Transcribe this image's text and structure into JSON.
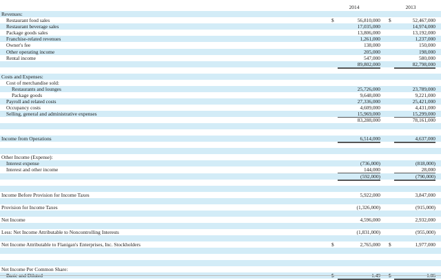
{
  "columns": {
    "y2014": "2014",
    "y2013": "2013",
    "currency": "$"
  },
  "rows": [
    {
      "label": "Revenues:",
      "indent": 0,
      "band": true
    },
    {
      "label": "Restaurant food sales",
      "indent": 1,
      "v2014": "56,810,000",
      "v2013": "52,467,000",
      "cur": true
    },
    {
      "label": "Restaurant beverage sales",
      "indent": 1,
      "v2014": "17,035,000",
      "v2013": "14,974,000",
      "band": true
    },
    {
      "label": "Package goods sales",
      "indent": 1,
      "v2014": "13,806,000",
      "v2013": "13,192,000"
    },
    {
      "label": "Franchise-related revenues",
      "indent": 1,
      "v2014": "1,261,000",
      "v2013": "1,237,000",
      "band": true
    },
    {
      "label": "Owner's fee",
      "indent": 1,
      "v2014": "138,000",
      "v2013": "150,000"
    },
    {
      "label": "Other operating income",
      "indent": 1,
      "v2014": "205,000",
      "v2013": "198,000",
      "band": true
    },
    {
      "label": "Rental income",
      "indent": 1,
      "v2014": "547,000",
      "v2013": "580,000",
      "ul": true
    },
    {
      "label": "",
      "indent": 0,
      "v2014": "89,802,000",
      "v2013": "82,798,000",
      "band": true,
      "dbl": true
    },
    {
      "label": "",
      "indent": 0
    },
    {
      "label": "Costs and Expenses:",
      "indent": 0,
      "band": true
    },
    {
      "label": "Cost of merchandise sold:",
      "indent": 1
    },
    {
      "label": "Restaurants and lounges",
      "indent": 2,
      "v2014": "25,726,000",
      "v2013": "23,789,000",
      "band": true
    },
    {
      "label": "Package goods",
      "indent": 2,
      "v2014": "9,648,000",
      "v2013": "9,221,000"
    },
    {
      "label": "Payroll and related costs",
      "indent": 1,
      "v2014": "27,336,000",
      "v2013": "25,421,000",
      "band": true
    },
    {
      "label": "Occupancy costs",
      "indent": 1,
      "v2014": "4,609,000",
      "v2013": "4,431,000"
    },
    {
      "label": "Selling, general and administrative expenses",
      "indent": 1,
      "v2014": "15,969,000",
      "v2013": "15,299,000",
      "band": true,
      "ul": true
    },
    {
      "label": "",
      "indent": 0,
      "v2014": "83,288,000",
      "v2013": "78,161,000",
      "dbl": true
    },
    {
      "label": "",
      "indent": 0,
      "band": true
    },
    {
      "label": "",
      "indent": 0
    },
    {
      "label": "Income from Operations",
      "indent": 0,
      "v2014": "6,514,000",
      "v2013": "4,637,000",
      "band": true,
      "dbl": true
    },
    {
      "label": "",
      "indent": 0
    },
    {
      "label": "",
      "indent": 0,
      "band": true
    },
    {
      "label": "Other Income (Expense):",
      "indent": 0
    },
    {
      "label": "Interest expense",
      "indent": 1,
      "v2014": "(736,000)",
      "v2013": "(818,000)",
      "band": true
    },
    {
      "label": "Interest and other income",
      "indent": 1,
      "v2014": "144,000",
      "v2013": "28,000",
      "ul": true
    },
    {
      "label": "",
      "indent": 0,
      "v2014": "(592,000)",
      "v2013": "(790,000)",
      "band": true,
      "dbl": true
    },
    {
      "label": "",
      "indent": 0
    },
    {
      "label": "",
      "indent": 0,
      "band": true
    },
    {
      "label": "Income Before Provision for Income Taxes",
      "indent": 0,
      "v2014": "5,922,000",
      "v2013": "3,847,000"
    },
    {
      "label": "",
      "indent": 0,
      "band": true
    },
    {
      "label": "Provision for Income Taxes",
      "indent": 0,
      "v2014": "(1,326,000)",
      "v2013": "(915,000)",
      "dbl": true
    },
    {
      "label": "",
      "indent": 0,
      "band": true
    },
    {
      "label": "Net Income",
      "indent": 0,
      "v2014": "4,596,000",
      "v2013": "2,932,000"
    },
    {
      "label": "",
      "indent": 0,
      "band": true
    },
    {
      "label": "Less: Net Income Attributable to Noncontrolling Interests",
      "indent": 0,
      "v2014": "(1,831,000)",
      "v2013": "(955,000)",
      "dbl": true
    },
    {
      "label": "",
      "indent": 0,
      "band": true
    },
    {
      "label": "Net Income Attributable to Flanigan's Enterprises, Inc. Stockholders",
      "indent": 0,
      "v2014": "2,765,000",
      "v2013": "1,977,000",
      "cur": true,
      "dbl": true
    },
    {
      "label": "",
      "indent": 0,
      "band": true
    },
    {
      "label": "",
      "indent": 0
    },
    {
      "label": "",
      "indent": 0,
      "band": true
    },
    {
      "label": "Net Income Per Common Share:",
      "indent": 0
    },
    {
      "label": "Basic and Diluted",
      "indent": 1,
      "v2014": "1.49",
      "v2013": "1.06",
      "cur": true,
      "band": true,
      "dbl": true
    }
  ]
}
